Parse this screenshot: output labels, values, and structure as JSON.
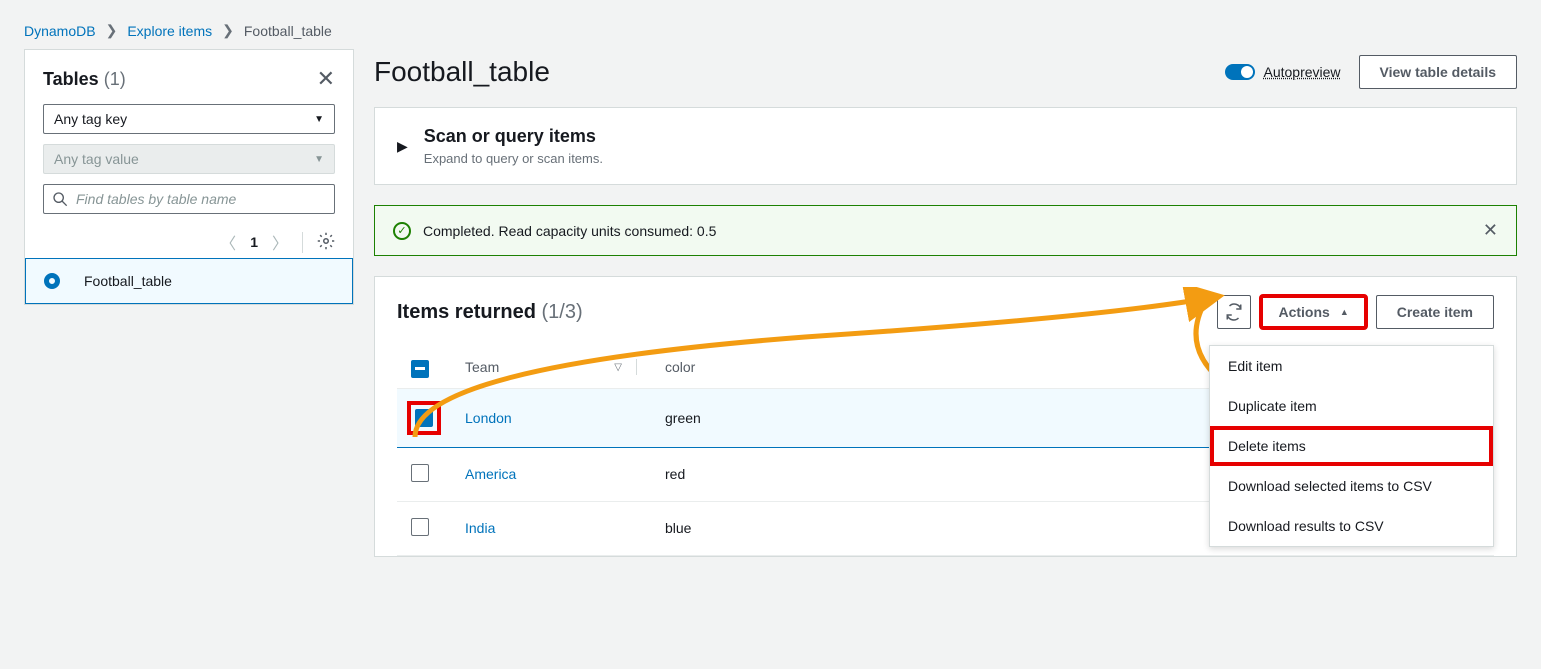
{
  "breadcrumbs": {
    "root": "DynamoDB",
    "explore": "Explore items",
    "current": "Football_table"
  },
  "sidebar": {
    "title": "Tables",
    "count": "(1)",
    "tag_key_placeholder": "Any tag key",
    "tag_value_placeholder": "Any tag value",
    "search_placeholder": "Find tables by table name",
    "page": "1",
    "selected_table": "Football_table"
  },
  "page": {
    "title": "Football_table",
    "autopreview": "Autopreview",
    "view_details": "View table details"
  },
  "scan": {
    "title": "Scan or query items",
    "subtitle": "Expand to query or scan items."
  },
  "notice": {
    "text": "Completed. Read capacity units consumed: 0.5"
  },
  "items": {
    "title": "Items returned",
    "count": "(1/3)",
    "actions_label": "Actions",
    "create_label": "Create item",
    "columns": {
      "team": "Team",
      "color": "color"
    },
    "rows": [
      {
        "team": "London",
        "color": "green",
        "checked": true
      },
      {
        "team": "America",
        "color": "red",
        "checked": false
      },
      {
        "team": "India",
        "color": "blue",
        "checked": false
      }
    ]
  },
  "dropdown": {
    "edit": "Edit item",
    "duplicate": "Duplicate item",
    "delete": "Delete items",
    "download_sel": "Download selected items to CSV",
    "download_all": "Download results to CSV"
  }
}
